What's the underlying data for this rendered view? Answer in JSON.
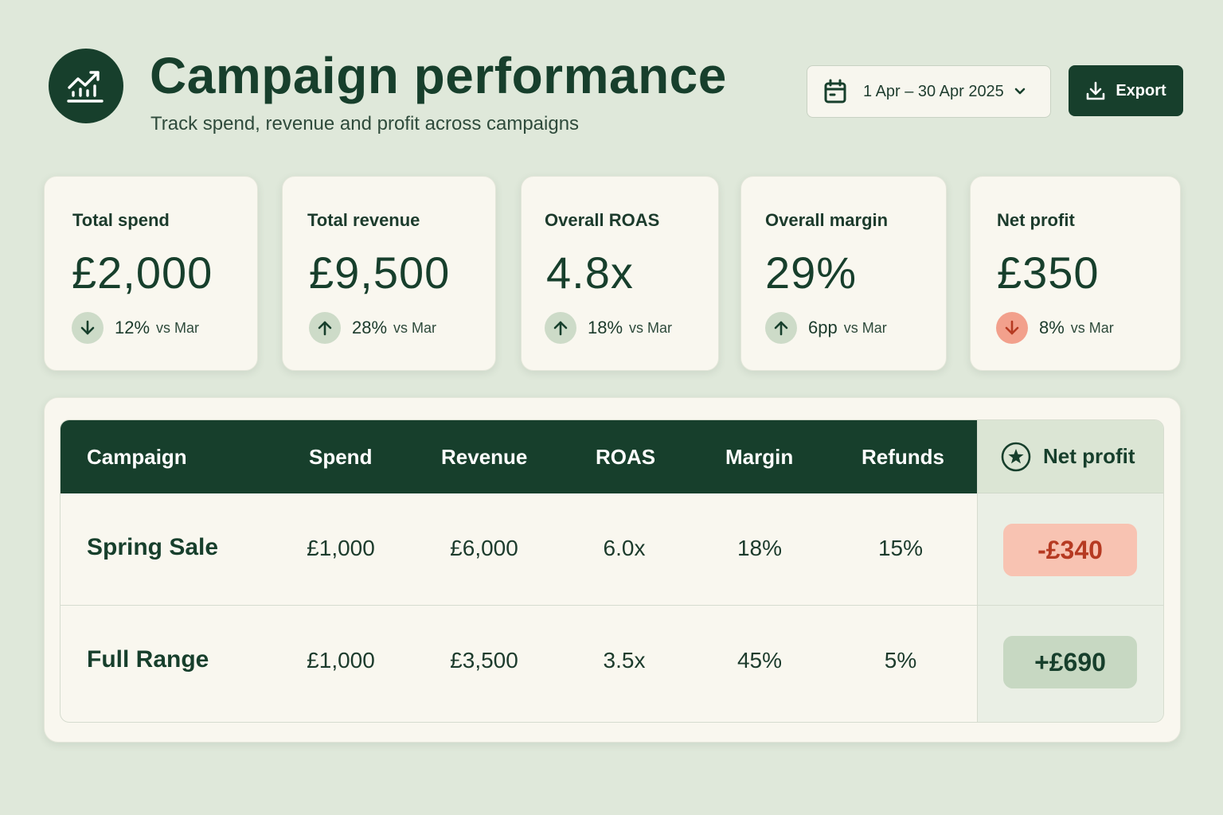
{
  "header": {
    "title": "Campaign performance",
    "subtitle": "Track spend, revenue and profit across campaigns",
    "logo_icon": "trending-up-chart-icon"
  },
  "toolbar": {
    "date_range": "1 Apr – 30 Apr 2025",
    "export_label": "Export"
  },
  "kpis": [
    {
      "label": "Total spend",
      "value": "£2,000",
      "delta": "12%",
      "vs": "vs Mar",
      "direction": "down",
      "tone": "neutral"
    },
    {
      "label": "Total revenue",
      "value": "£9,500",
      "delta": "28%",
      "vs": "vs Mar",
      "direction": "up",
      "tone": "positive"
    },
    {
      "label": "Overall ROAS",
      "value": "4.8x",
      "delta": "18%",
      "vs": "vs Mar",
      "direction": "up",
      "tone": "positive"
    },
    {
      "label": "Overall margin",
      "value": "29%",
      "delta": "6pp",
      "vs": "vs Mar",
      "direction": "up",
      "tone": "positive"
    },
    {
      "label": "Net profit",
      "value": "£350",
      "delta": "8%",
      "vs": "vs Mar",
      "direction": "down",
      "tone": "negative"
    }
  ],
  "table": {
    "columns": [
      "Campaign",
      "Spend",
      "Revenue",
      "ROAS",
      "Margin",
      "Refunds",
      "Net profit"
    ],
    "rows": [
      {
        "campaign": "Spring Sale",
        "spend": "£1,000",
        "revenue": "£6,000",
        "roas": "6.0x",
        "margin": "18%",
        "refunds": "15%",
        "net_profit": "-£340",
        "tone": "negative"
      },
      {
        "campaign": "Full Range",
        "spend": "£1,000",
        "revenue": "£3,500",
        "roas": "3.5x",
        "margin": "45%",
        "refunds": "5%",
        "net_profit": "+£690",
        "tone": "positive"
      }
    ]
  },
  "colors": {
    "background": "#dfe8da",
    "brand_dark_green": "#173f2c",
    "card": "#f9f7ef",
    "negative_bg": "#f8c3b2",
    "negative_text": "#b63a22",
    "positive_bg": "#c7d8c2"
  }
}
